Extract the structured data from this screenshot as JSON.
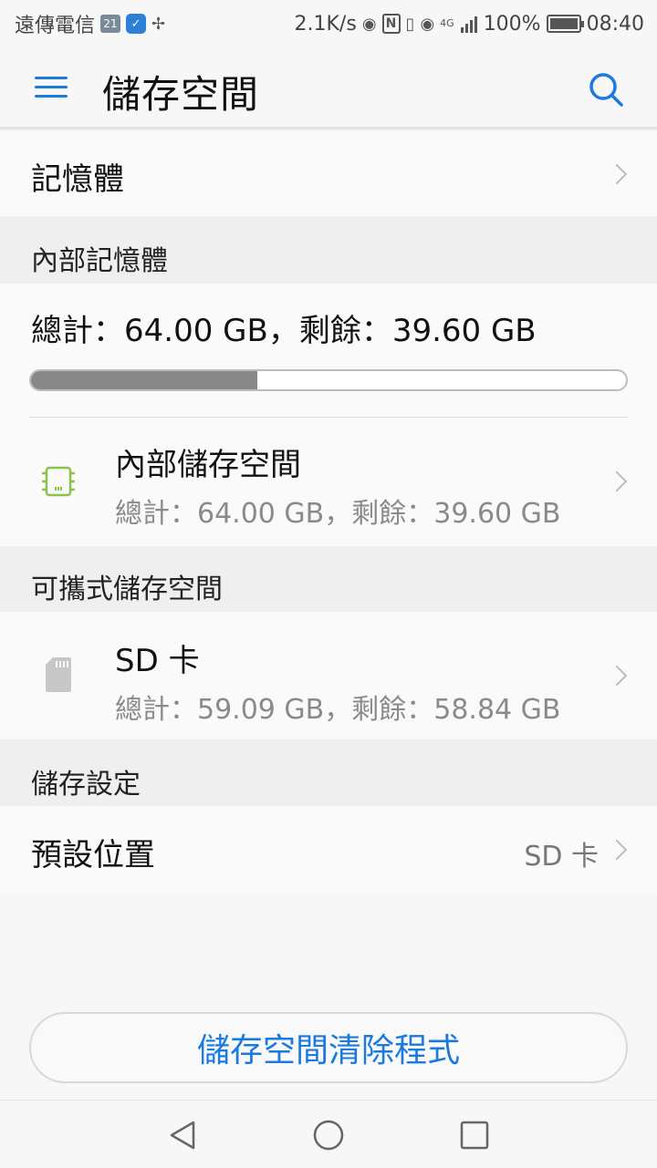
{
  "status_bar": {
    "carrier": "遠傳電信",
    "calendar_badge": "21",
    "net_speed": "2.1K/s",
    "signal_label": "4G",
    "battery": "100%",
    "time": "08:40"
  },
  "app_bar": {
    "title": "儲存空間"
  },
  "memory_row": {
    "label": "記憶體"
  },
  "internal_section": {
    "header": "內部記憶體",
    "total_text": "總計：64.00 GB，剩餘：39.60 GB",
    "used_fraction": 0.38,
    "item_title": "內部儲存空間",
    "item_sub": "總計：64.00 GB，剩餘：39.60 GB"
  },
  "portable_section": {
    "header": "可攜式儲存空間",
    "item_title": "SD 卡",
    "item_sub": "總計：59.09 GB，剩餘：58.84 GB"
  },
  "settings_section": {
    "header": "儲存設定",
    "default_location_label": "預設位置",
    "default_location_value": "SD 卡"
  },
  "cleanup_button": {
    "label": "儲存空間清除程式"
  },
  "colors": {
    "accent": "#1a7ae0",
    "chip_green": "#8bc34a",
    "progress_fill": "#888888"
  }
}
